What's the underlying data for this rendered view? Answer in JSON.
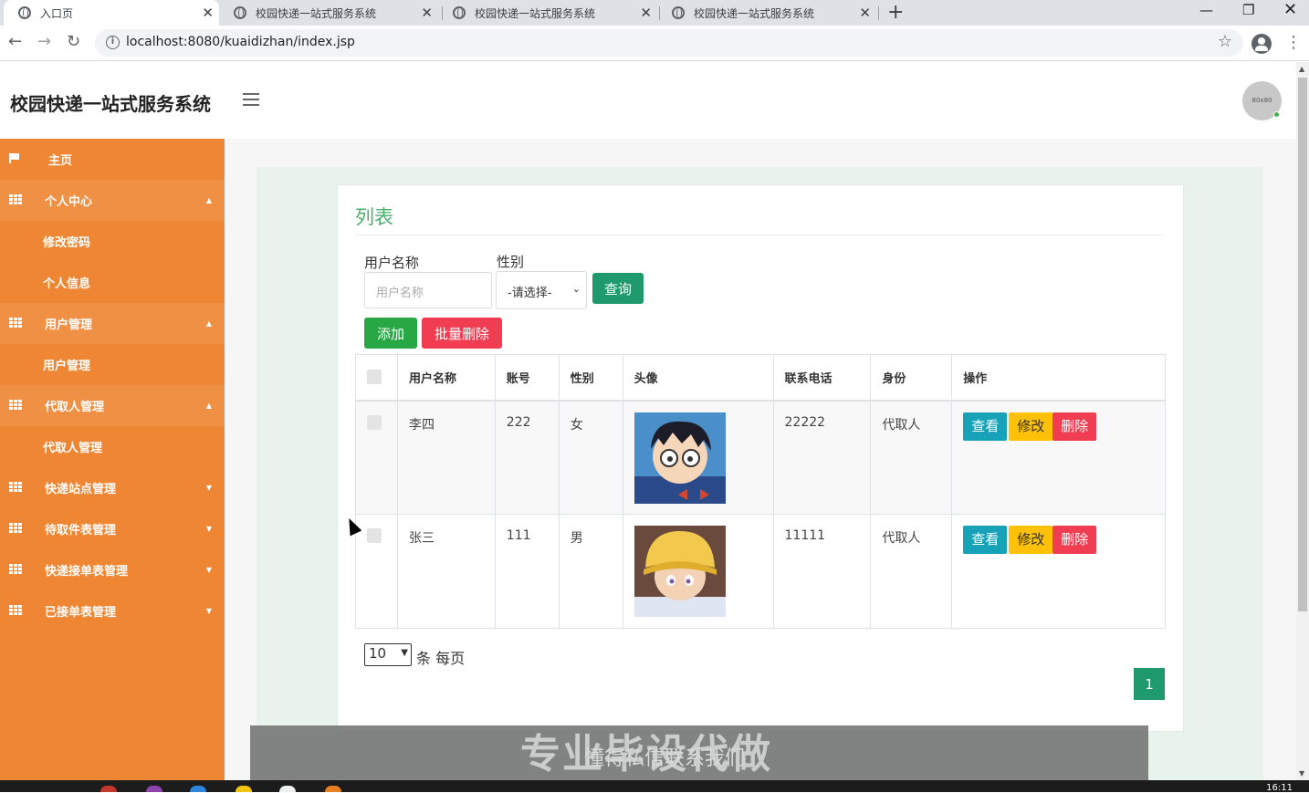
{
  "browser": {
    "tabs": [
      {
        "title": "入口页",
        "active": true
      },
      {
        "title": "校园快递一站式服务系统",
        "active": false
      },
      {
        "title": "校园快递一站式服务系统",
        "active": false
      },
      {
        "title": "校园快递一站式服务系统",
        "active": false
      }
    ],
    "url": "localhost:8080/kuaidizhan/index.jsp"
  },
  "header": {
    "title": "校园快递一站式服务系统",
    "avatar_text": "80x80"
  },
  "sidebar": {
    "items": [
      {
        "label": "主页",
        "type": "home"
      },
      {
        "label": "个人中心",
        "type": "parent",
        "expanded": true
      },
      {
        "label": "修改密码",
        "type": "sub"
      },
      {
        "label": "个人信息",
        "type": "sub"
      },
      {
        "label": "用户管理",
        "type": "parent",
        "expanded": true
      },
      {
        "label": "用户管理",
        "type": "sub"
      },
      {
        "label": "代取人管理",
        "type": "parent",
        "expanded": true
      },
      {
        "label": "代取人管理",
        "type": "sub"
      },
      {
        "label": "快递站点管理",
        "type": "collapsed"
      },
      {
        "label": "待取件表管理",
        "type": "collapsed"
      },
      {
        "label": "快递接单表管理",
        "type": "collapsed"
      },
      {
        "label": "已接单表管理",
        "type": "collapsed"
      }
    ]
  },
  "main": {
    "card_title": "列表",
    "search": {
      "username_label": "用户名称",
      "username_placeholder": "用户名称",
      "gender_label": "性别",
      "gender_selected": "-请选择-",
      "query_button": "查询"
    },
    "actions": {
      "add_button": "添加",
      "batch_delete_button": "批量删除"
    },
    "table": {
      "columns": [
        "",
        "用户名称",
        "账号",
        "性别",
        "头像",
        "联系电话",
        "身份",
        "操作"
      ],
      "rows": [
        {
          "name": "李四",
          "account": "222",
          "gender": "女",
          "avatar": "cartoon-boy-glasses",
          "phone": "22222",
          "role": "代取人"
        },
        {
          "name": "张三",
          "account": "111",
          "gender": "男",
          "avatar": "cartoon-boy-yellow-hat",
          "phone": "11111",
          "role": "代取人"
        }
      ],
      "row_actions": {
        "view": "查看",
        "edit": "修改",
        "delete": "删除"
      }
    },
    "pagination": {
      "page_size": "10",
      "per_page_text": "条 每页",
      "current_page": "1"
    }
  },
  "overlay": {
    "big_text": "专业毕设代做",
    "small_text": "懂得私信联系我们"
  },
  "taskbar": {
    "clock": "16:11"
  },
  "colors": {
    "sidebar": "#ef8634",
    "accent_green": "#1e9a6c",
    "title_green": "#4cae6c",
    "danger": "#f03d52",
    "info": "#17a2b8",
    "warning": "#ffc107",
    "success": "#28a745"
  }
}
